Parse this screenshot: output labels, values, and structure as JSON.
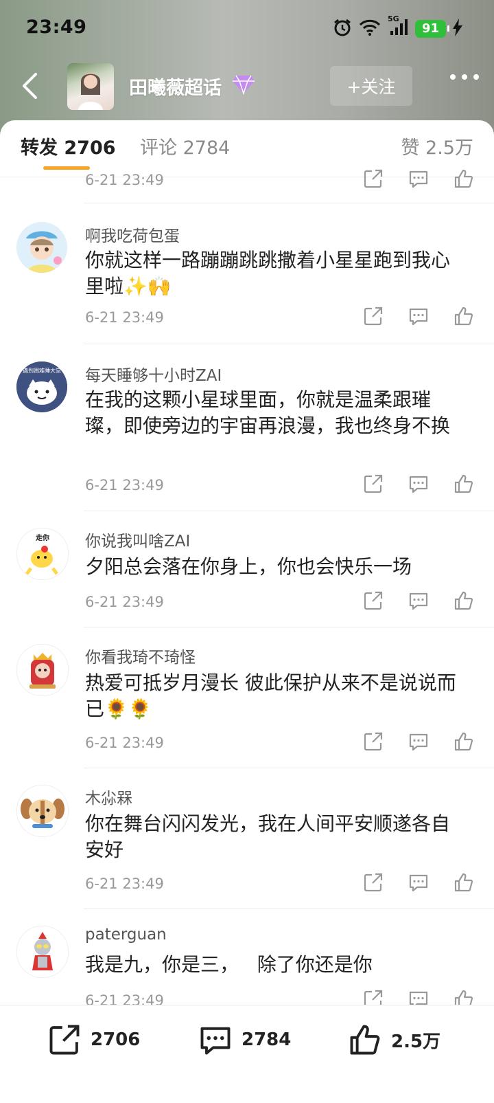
{
  "status_bar": {
    "time": "23:49",
    "network": "5G",
    "battery": "91"
  },
  "header": {
    "title": "田曦薇超话",
    "follow_label": "+关注"
  },
  "tabs": {
    "repost": "转发 2706",
    "comment": "评论 2784",
    "likes": "赞 2.5万"
  },
  "partial_top": {
    "time": "6-21 23:49"
  },
  "comments": [
    {
      "user": "啊我吃荷包蛋",
      "text": "你就这样一路蹦蹦跳跳撒着小星星跑到我心里啦✨🙌",
      "time": "6-21 23:49"
    },
    {
      "user": "每天睡够十小时ZAI",
      "text": "在我的这颗小星球里面，你就是温柔跟璀璨，即使旁边的宇宙再浪漫，我也终身不换",
      "time": "6-21 23:49",
      "avatar_text": "遇到困难睡大觉"
    },
    {
      "user": "你说我叫啥ZAI",
      "text": "夕阳总会落在你身上，你也会快乐一场",
      "time": "6-21 23:49",
      "avatar_text": "走你"
    },
    {
      "user": "你看我琦不琦怪",
      "text": "热爱可抵岁月漫长 彼此保护从来不是说说而已🌻🌻",
      "time": "6-21 23:49"
    },
    {
      "user": "木尛槑",
      "text": "你在舞台闪闪发光，我在人间平安顺遂各自安好",
      "time": "6-21 23:49"
    },
    {
      "user": "paterguan",
      "text": "我是九，你是三，   除了你还是你",
      "time": "6-21 23:49"
    }
  ],
  "bottom_bar": {
    "reposts": "2706",
    "comments": "2784",
    "likes": "2.5万"
  }
}
